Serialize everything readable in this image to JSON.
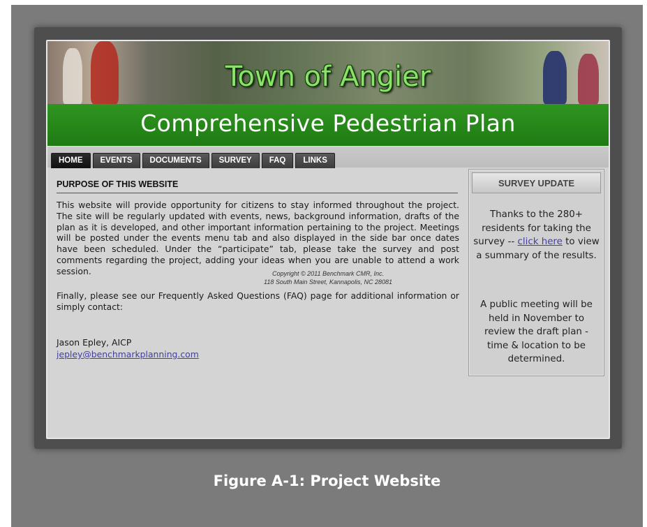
{
  "banner": {
    "title": "Town of Angier",
    "subtitle": "Comprehensive Pedestrian Plan"
  },
  "nav": {
    "tabs": [
      {
        "label": "HOME"
      },
      {
        "label": "EVENTS"
      },
      {
        "label": "DOCUMENTS"
      },
      {
        "label": "SURVEY"
      },
      {
        "label": "FAQ"
      },
      {
        "label": "LINKS"
      }
    ],
    "active": "HOME"
  },
  "main": {
    "heading": "PURPOSE OF THIS WEBSITE",
    "paragraph1": "This website will provide opportunity for citizens to stay informed throughout the project.  The site will be regularly updated with events, news, background information, drafts of the plan as it is developed, and other important information pertaining to the project.  Meetings will be posted under the events menu tab and also displayed in the side bar once dates have been scheduled.  Under the “participate” tab, please take the survey and post comments regarding the project, adding your ideas when you are unable to attend a work session.",
    "paragraph2": "Finally, please see our Frequently Asked Questions (FAQ) page for additional information or simply contact:",
    "contact_name": "Jason Epley, AICP",
    "contact_email": "jepley@benchmarkplanning.com"
  },
  "sidebar": {
    "header": "SURVEY UPDATE",
    "text1_before": "Thanks to the 280+ residents for taking the survey -- ",
    "text1_link": "click here",
    "text1_after": " to view a summary of the results.",
    "text2": "A public meeting will be held in November to review the draft plan - time & location to be determined."
  },
  "footer": {
    "line1": "Copyright © 2011 Benchmark CMR, Inc.",
    "line2": "118 South Main Street, Kannapolis, NC 28081"
  },
  "caption": "Figure A-1: Project Website",
  "colors": {
    "banner_green": "#268719",
    "title_green": "#8be26a",
    "link": "#3f3fa6",
    "outer_gray": "#7b7b7b"
  }
}
